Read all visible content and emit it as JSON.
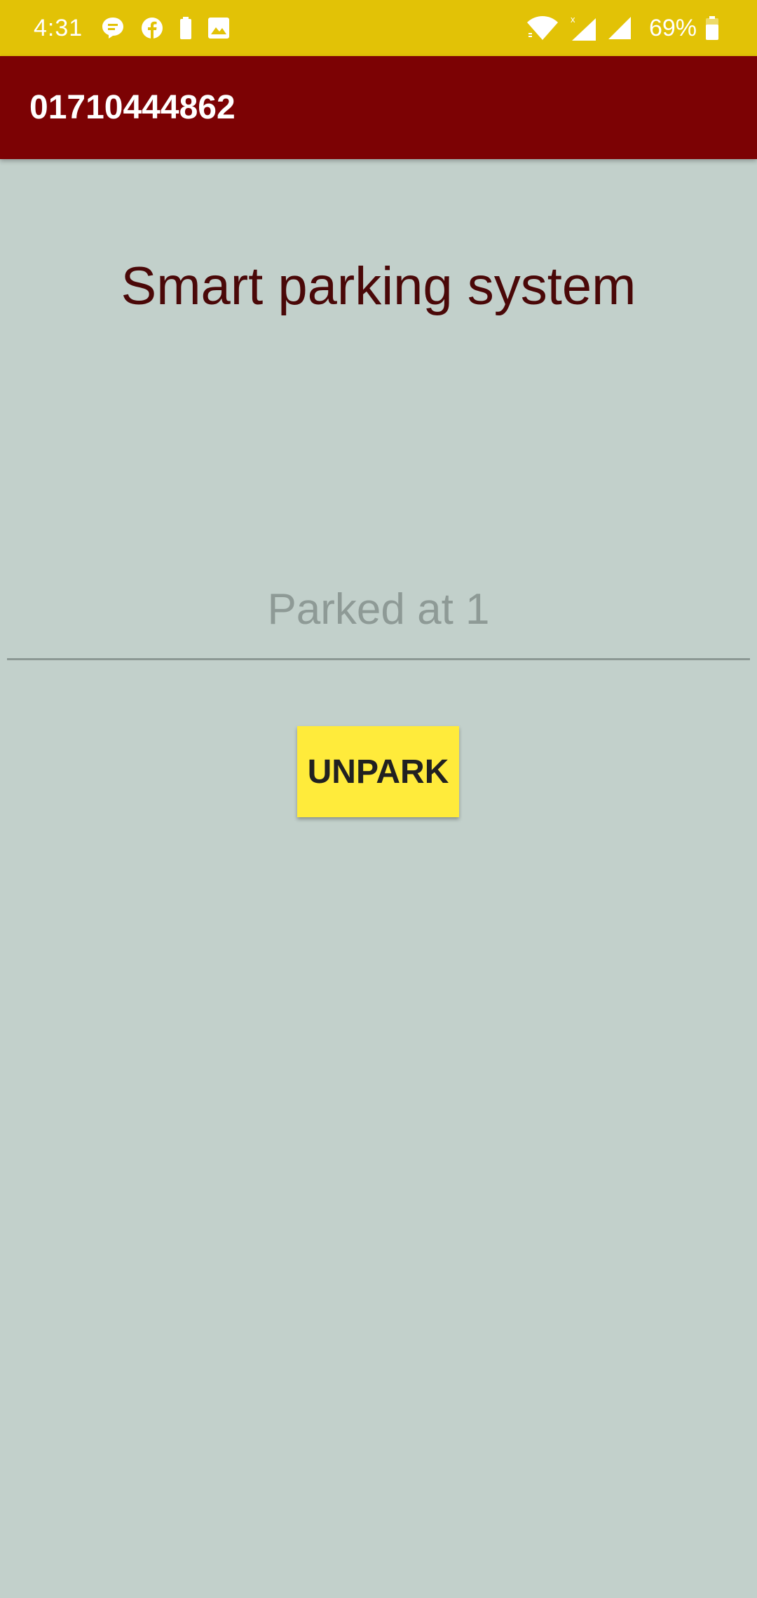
{
  "status_bar": {
    "time": "4:31",
    "left_icons": [
      "chat-bubble-icon",
      "facebook-icon",
      "battery-saver-icon",
      "image-icon"
    ],
    "right_icons": [
      "wifi-icon",
      "cell-signal-x-icon",
      "cell-signal-icon"
    ],
    "battery_percent": "69%",
    "background_color": "#e2c206"
  },
  "app_bar": {
    "title": "01710444862",
    "background_color": "#7c0204"
  },
  "main": {
    "headline": "Smart parking system",
    "status_text": "Parked at 1",
    "unpark_label": "UNPARK",
    "button_color": "#ffeb3b",
    "background_color": "#c2d0cb"
  }
}
